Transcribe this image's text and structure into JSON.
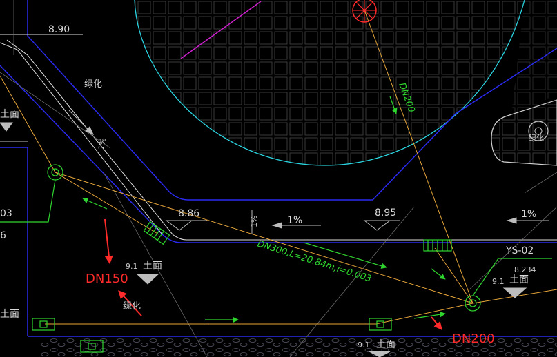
{
  "elevations": {
    "e890": "8.90",
    "e886": "8.86",
    "e895": "8.95",
    "e8234": "8.234"
  },
  "ground": {
    "label": "土面",
    "left_partial": "土面",
    "bottom_left_partial": "土面",
    "n91": "9.1"
  },
  "greenery": "绿化",
  "greenery_island": "绿化",
  "slopes": {
    "s1": "1%",
    "s2": "1%",
    "s3": "1%",
    "s4": "1%"
  },
  "pipes": {
    "dn200_diag": "DN200",
    "main": "DN300,L=20.84m,i=0.003"
  },
  "well_id": "YS-02",
  "annotations": {
    "dn150": "DN150",
    "dn200": "DN200"
  },
  "partial_left": {
    "a": "03",
    "b": "6"
  },
  "colors": {
    "background": "#000000",
    "pipe": "#e8a63a",
    "road_edge": "#2a2af0",
    "plaza_edge": "#2ad4e0",
    "green_symbol": "#2fd62f",
    "annotation": "#ff2a2a",
    "magenta_line": "#d020d0"
  }
}
